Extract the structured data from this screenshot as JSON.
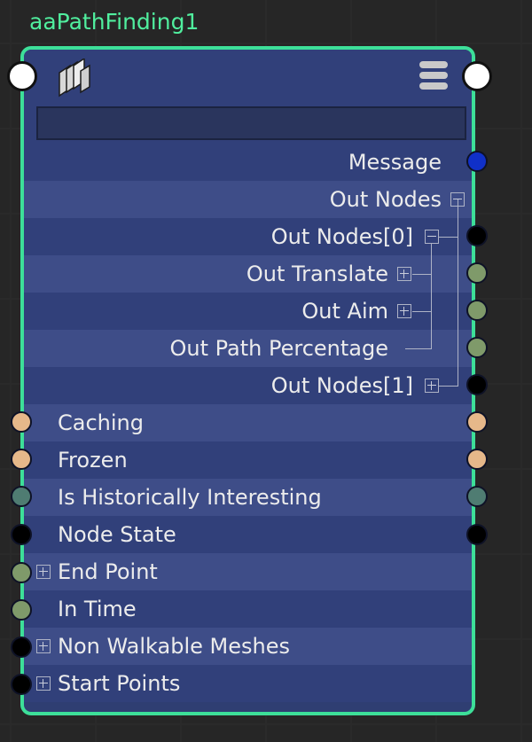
{
  "node": {
    "title": "aaPathFinding1",
    "icon": "node-type-icon",
    "menu_icon": "menu-icon",
    "search_value": ""
  },
  "colors": {
    "border": "#3ddf99",
    "title": "#50ee9e",
    "message_port": "#1030c8",
    "black_port": "#000000",
    "peach_port": "#e6b88a",
    "teal_port": "#4f7c72",
    "olive_port": "#7f9a6a"
  },
  "output_attributes": [
    {
      "label": "Message"
    },
    {
      "label": "Out Nodes",
      "expander": "collapse"
    },
    {
      "label": "Out Nodes[0]",
      "expander": "collapse"
    },
    {
      "label": "Out Translate",
      "expander": "expand"
    },
    {
      "label": "Out Aim",
      "expander": "expand"
    },
    {
      "label": "Out Path Percentage"
    },
    {
      "label": "Out Nodes[1]",
      "expander": "expand"
    }
  ],
  "input_attributes": [
    {
      "label": "Caching"
    },
    {
      "label": "Frozen"
    },
    {
      "label": "Is Historically Interesting"
    },
    {
      "label": "Node State"
    },
    {
      "label": "End Point",
      "expander": "expand"
    },
    {
      "label": "In Time"
    },
    {
      "label": "Non Walkable Meshes",
      "expander": "expand"
    },
    {
      "label": "Start Points",
      "expander": "expand"
    }
  ]
}
